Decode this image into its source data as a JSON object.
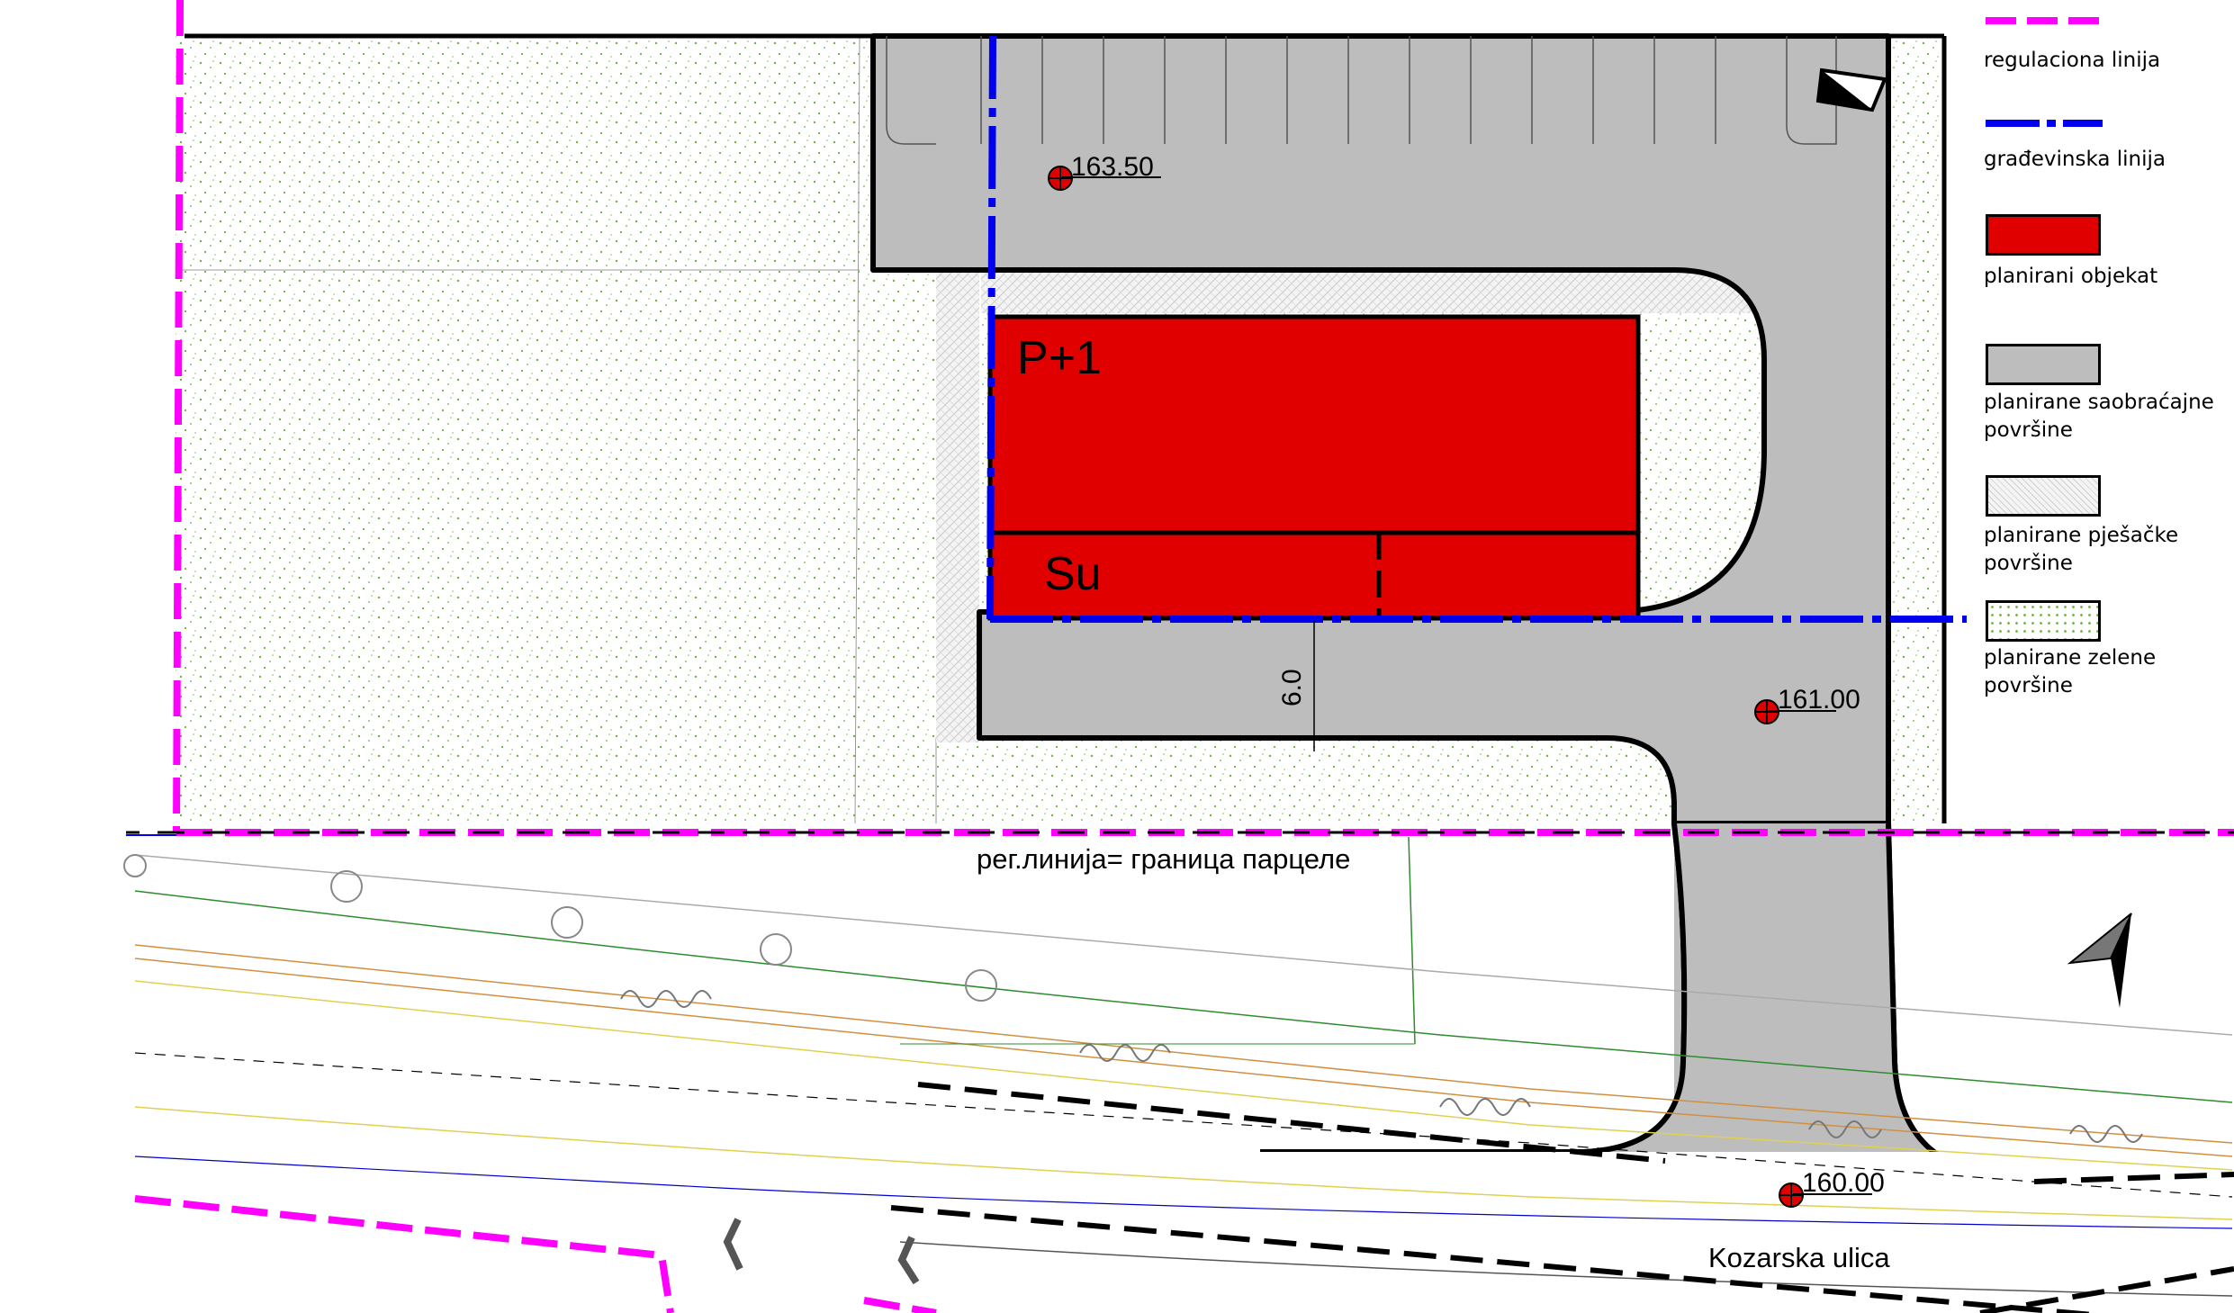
{
  "legend": {
    "items": [
      {
        "label": "regulaciona linija",
        "symbol": "dashed-magenta-line",
        "color": "#ff00ff"
      },
      {
        "label": "građevinska linija",
        "symbol": "dash-dot-blue-line",
        "color": "#0000ee"
      },
      {
        "label": "planirani objekat",
        "symbol": "red-fill-box",
        "color": "#e00000"
      },
      {
        "label": "planirane saobraćajne površine",
        "symbol": "gray-fill-box",
        "color": "#bdbdbd"
      },
      {
        "label": "planirane pješačke površine",
        "symbol": "hatched-box",
        "color": "#e9e9e9"
      },
      {
        "label": "planirane zelene površine",
        "symbol": "green-dotted-box",
        "color": "#6db33f"
      }
    ]
  },
  "plan": {
    "building_upper_label": "P+1",
    "building_lower_label": "Su",
    "elevation_parking": "163.50",
    "elevation_access": "161.00",
    "elevation_street": "160.00",
    "dimension_label": "6.0",
    "boundary_note": "рег.линија= граница парцеле",
    "street_name": "Kozarska ulica"
  },
  "colors": {
    "building": "#e00000",
    "traffic_area": "#bdbdbd",
    "green_area_dots": "#6db33f",
    "regulation_line": "#ff00ff",
    "building_line": "#0000ee"
  }
}
